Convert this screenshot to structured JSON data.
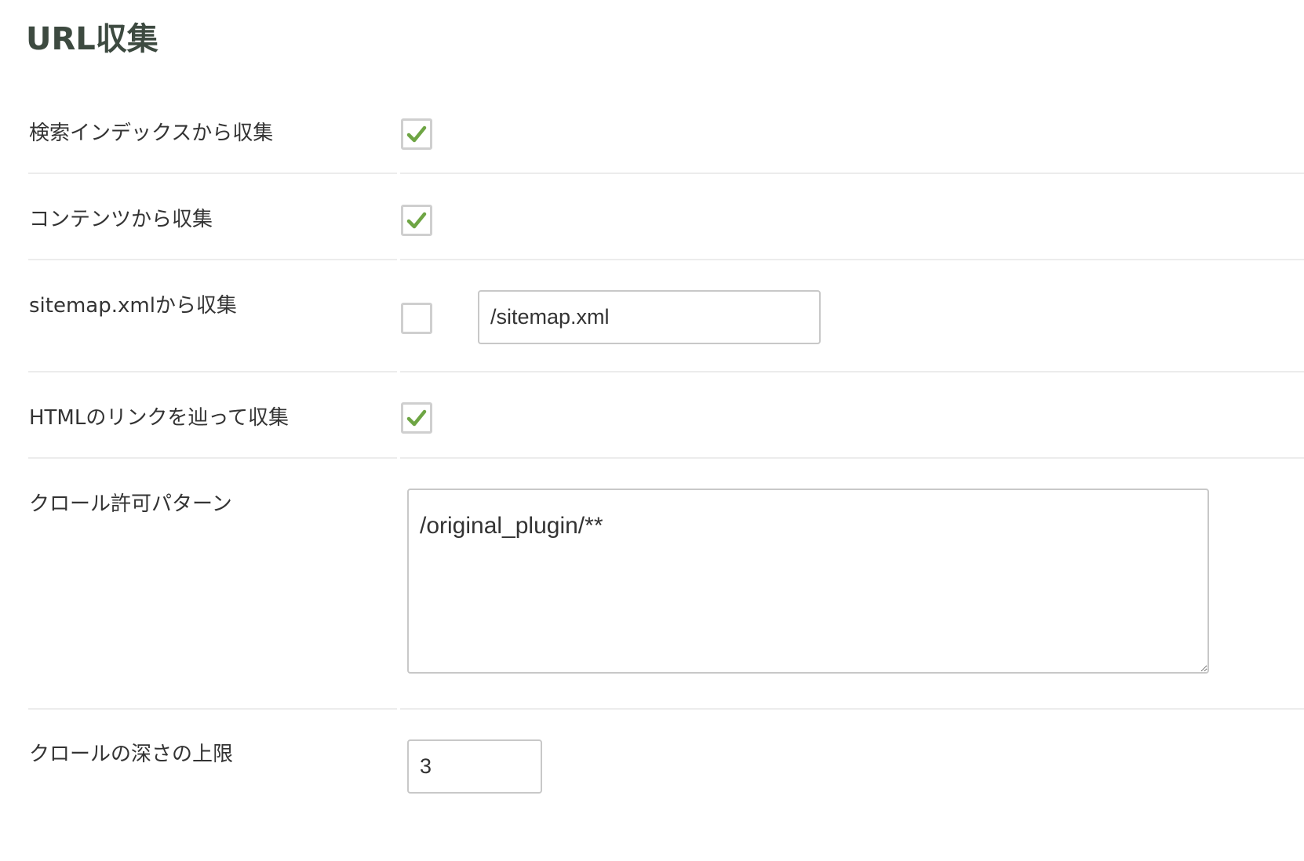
{
  "title": "URL収集",
  "rows": [
    {
      "label": "検索インデックスから収集",
      "checked": true
    },
    {
      "label": "コンテンツから収集",
      "checked": true
    },
    {
      "label": "sitemap.xmlから収集",
      "checked": false,
      "input_value": "/sitemap.xml"
    },
    {
      "label": "HTMLのリンクを辿って収集",
      "checked": true
    },
    {
      "label": "クロール許可パターン",
      "textarea_value": "/original_plugin/**"
    },
    {
      "label": "クロールの深さの上限",
      "input_value": "3"
    }
  ],
  "colors": {
    "check_mark": "#6ea544",
    "title": "#3d4a40",
    "divider": "#ececec"
  },
  "icons": {
    "check": "check-icon"
  }
}
